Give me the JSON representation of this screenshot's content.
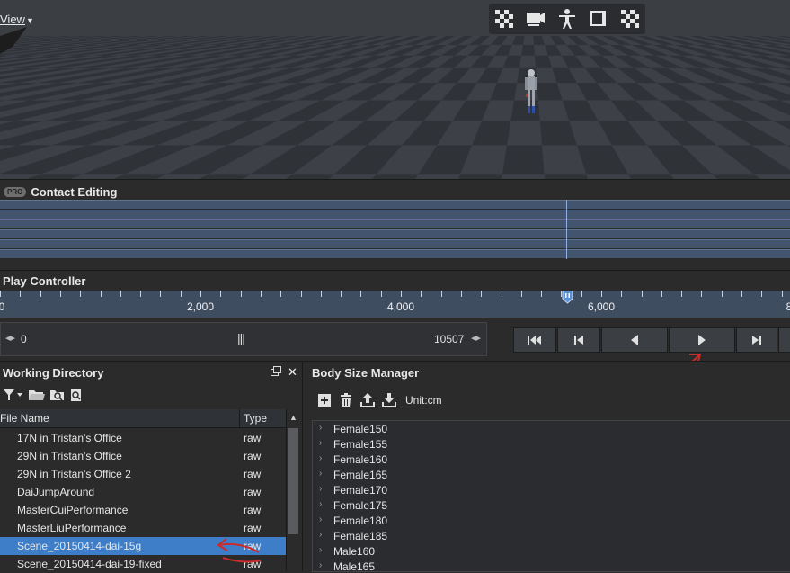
{
  "viewport": {
    "view_menu": "View",
    "toolbar_icons": [
      "checker-icon",
      "camera-icon",
      "character-icon",
      "frame-icon",
      "checker-icon"
    ]
  },
  "contact_panel": {
    "badge": "PRO",
    "title": "Contact Editing"
  },
  "play_panel": {
    "title": "Play Controller",
    "ruler_labels": [
      "0",
      "2,000",
      "4,000",
      "6,000",
      "8"
    ],
    "range_start": "0",
    "range_end": "10507",
    "buttons": [
      "go-to-start-icon",
      "previous-key-icon",
      "step-back-icon",
      "play-icon",
      "go-to-end-icon"
    ]
  },
  "working_directory": {
    "title": "Working Directory",
    "columns": [
      "File Name",
      "Type"
    ],
    "files": [
      {
        "name": "17N in Tristan's Office",
        "type": "raw"
      },
      {
        "name": "29N in Tristan's Office",
        "type": "raw"
      },
      {
        "name": "29N in Tristan's Office 2",
        "type": "raw"
      },
      {
        "name": "DaiJumpAround",
        "type": "raw"
      },
      {
        "name": "MasterCuiPerformance",
        "type": "raw"
      },
      {
        "name": "MasterLiuPerformance",
        "type": "raw"
      },
      {
        "name": "Scene_20150414-dai-15g",
        "type": "raw",
        "selected": true
      },
      {
        "name": "Scene_20150414-dai-19-fixed",
        "type": "raw"
      }
    ]
  },
  "body_size_manager": {
    "title": "Body Size Manager",
    "unit_label": "Unit:cm",
    "items": [
      "Female150",
      "Female155",
      "Female160",
      "Female165",
      "Female170",
      "Female175",
      "Female180",
      "Female185",
      "Male160",
      "Male165"
    ]
  },
  "colors": {
    "selection": "#3e7ec8",
    "annotation": "#cc2b2b",
    "ruler": "#3f4d61"
  }
}
